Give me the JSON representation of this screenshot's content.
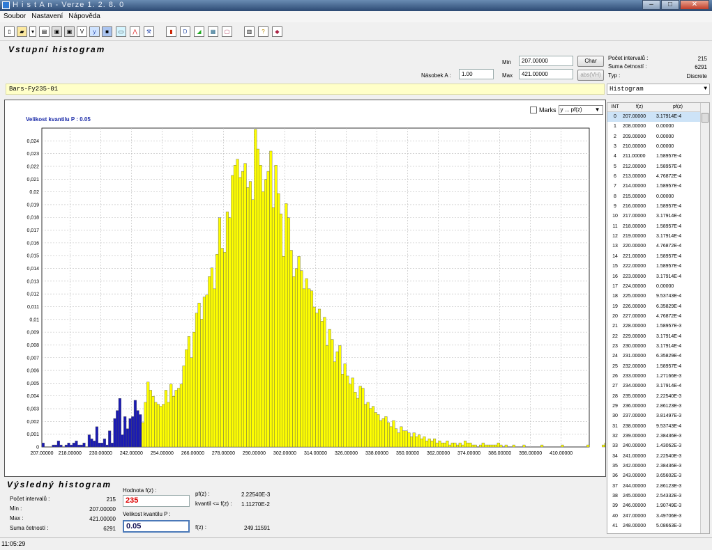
{
  "window": {
    "title": "H i s t A n  -  Verze 1. 2. 8. 0"
  },
  "menu": [
    "Soubor",
    "Nastavení",
    "Nápověda"
  ],
  "input_panel": {
    "title": "Vstupní histogram",
    "min_label": "Min",
    "min_value": "207.00000",
    "max_label": "Max",
    "max_value": "421.00000",
    "nasobek_label": "Násobek A :",
    "nasobek_value": "1.00",
    "char_button": "Char",
    "abs_button": "abs(VH)",
    "pocet_label": "Počet intervalů :",
    "pocet_value": "215",
    "suma_label": "Suma četností :",
    "suma_value": "6291",
    "typ_label": "Typ :",
    "typ_value": "Discrete"
  },
  "dataset_name": "Bars-Fy235-01",
  "view_select": "Histogram",
  "chart_header": {
    "quantile_label": "Velikost kvantilu P : 0.05",
    "marks_label": "Marks",
    "axis_select": "y ... pf(z)"
  },
  "chart_data": {
    "type": "bar",
    "x_start": 207,
    "x_step": 1,
    "xlim": [
      207,
      421
    ],
    "ylim": [
      0,
      0.025
    ],
    "x_ticks": [
      "207.00000",
      "218.00000",
      "230.00000",
      "242.00000",
      "254.00000",
      "266.00000",
      "278.00000",
      "290.00000",
      "302.00000",
      "314.00000",
      "326.00000",
      "338.00000",
      "350.00000",
      "362.00000",
      "374.00000",
      "386.00000",
      "398.00000",
      "410.00000"
    ],
    "y_ticks": [
      "0",
      "0,001",
      "0,002",
      "0,003",
      "0,004",
      "0,005",
      "0,006",
      "0,007",
      "0,008",
      "0,009",
      "0,01",
      "0,011",
      "0,012",
      "0,013",
      "0,014",
      "0,015",
      "0,016",
      "0,017",
      "0,018",
      "0,019",
      "0,02",
      "0,021",
      "0,022",
      "0,023",
      "0,024"
    ],
    "highlight_until_index": 38,
    "highlight_color": "#1a1ab4",
    "bar_color": "#ffff00",
    "grid": true,
    "values": [
      0.000318,
      0,
      0,
      0,
      0.000159,
      0.000159,
      0.000477,
      0.000159,
      0,
      0.000159,
      0.000318,
      0.000159,
      0.000318,
      0.000477,
      0.000159,
      0.000159,
      0.000318,
      0,
      0.000954,
      0.000636,
      0.000477,
      0.00159,
      0.000318,
      0.000318,
      0.000636,
      0.000159,
      0.00127,
      0.000318,
      0.00223,
      0.00286,
      0.00381,
      0.000954,
      0.00238,
      0.00143,
      0.00223,
      0.00238,
      0.00366,
      0.00286,
      0.00254,
      0.00191,
      0.0035,
      0.00509,
      0.00445,
      0.00397,
      0.0035,
      0.00334,
      0.00318,
      0.00334,
      0.00445,
      0.0035,
      0.00493,
      0.00397,
      0.00445,
      0.00461,
      0.00493,
      0.00636,
      0.00763,
      0.00867,
      0.007,
      0.009,
      0.01049,
      0.01129,
      0.01002,
      0.01176,
      0.01192,
      0.01336,
      0.01404,
      0.0124,
      0.01511,
      0.01797,
      0.01558,
      0.01526,
      0.01844,
      0.01797,
      0.02129,
      0.02209,
      0.02256,
      0.02113,
      0.02161,
      0.02223,
      0.02034,
      0.02082,
      0.01939,
      0.0249,
      0.02336,
      0.02209,
      0.02002,
      0.02097,
      0.02161,
      0.0232,
      0.01876,
      0.02209,
      0.01987,
      0.01828,
      0.01494,
      0.01908,
      0.01797,
      0.01542,
      0.01335,
      0.01399,
      0.01494,
      0.01383,
      0.0124,
      0.0132,
      0.0124,
      0.01224,
      0.01097,
      0.01049,
      0.01081,
      0.00986,
      0.01017,
      0.00795,
      0.00922,
      0.00843,
      0.00668,
      0.00747,
      0.00795,
      0.00572,
      0.00652,
      0.00557,
      0.00493,
      0.00541,
      0.00429,
      0.00382,
      0.00477,
      0.00461,
      0.00334,
      0.0035,
      0.00302,
      0.00318,
      0.0027,
      0.00254,
      0.00207,
      0.00222,
      0.00238,
      0.00191,
      0.00159,
      0.00207,
      0.00143,
      0.00111,
      0.00159,
      0.00127,
      0.00127,
      0.00111,
      0.0008,
      0.00111,
      0.0008,
      0.00095,
      0.00064,
      0.0008,
      0.00048,
      0.00064,
      0.00048,
      0.00064,
      0.00032,
      0.00048,
      0.00032,
      0.00032,
      0.00048,
      0.00016,
      0.00032,
      0.00032,
      0.00016,
      0.00032,
      0.00016,
      0.00048,
      0.00032,
      0.00032,
      0.00016,
      0.00016,
      0,
      0.00016,
      0.00032,
      0.00016,
      0.00016,
      0.00016,
      0.00016,
      0.00016,
      0.00032,
      0.00016,
      0,
      0.00016,
      0,
      0,
      0.00016,
      0,
      0,
      0,
      0.00016,
      0,
      0,
      0,
      0,
      0,
      0,
      0.00016,
      0,
      0,
      0,
      0,
      0,
      0,
      0,
      0.00016,
      0,
      0,
      0,
      0,
      0,
      0,
      0,
      0,
      0,
      0.00016,
      0,
      0,
      0,
      0,
      0,
      0.00016,
      0.00032
    ]
  },
  "table": {
    "headers": [
      "INT",
      "f(z)",
      "pf(z)"
    ],
    "rows": [
      [
        "0",
        "207.00000",
        "3.17914E-4"
      ],
      [
        "1",
        "208.00000",
        "0.00000"
      ],
      [
        "2",
        "209.00000",
        "0.00000"
      ],
      [
        "3",
        "210.00000",
        "0.00000"
      ],
      [
        "4",
        "211.00000",
        "1.58957E-4"
      ],
      [
        "5",
        "212.00000",
        "1.58957E-4"
      ],
      [
        "6",
        "213.00000",
        "4.76872E-4"
      ],
      [
        "7",
        "214.00000",
        "1.58957E-4"
      ],
      [
        "8",
        "215.00000",
        "0.00000"
      ],
      [
        "9",
        "216.00000",
        "1.58957E-4"
      ],
      [
        "10",
        "217.00000",
        "3.17914E-4"
      ],
      [
        "11",
        "218.00000",
        "1.58957E-4"
      ],
      [
        "12",
        "219.00000",
        "3.17914E-4"
      ],
      [
        "13",
        "220.00000",
        "4.76872E-4"
      ],
      [
        "14",
        "221.00000",
        "1.58957E-4"
      ],
      [
        "15",
        "222.00000",
        "1.58957E-4"
      ],
      [
        "16",
        "223.00000",
        "3.17914E-4"
      ],
      [
        "17",
        "224.00000",
        "0.00000"
      ],
      [
        "18",
        "225.00000",
        "9.53743E-4"
      ],
      [
        "19",
        "226.00000",
        "6.35829E-4"
      ],
      [
        "20",
        "227.00000",
        "4.76872E-4"
      ],
      [
        "21",
        "228.00000",
        "1.58957E-3"
      ],
      [
        "22",
        "229.00000",
        "3.17914E-4"
      ],
      [
        "23",
        "230.00000",
        "3.17914E-4"
      ],
      [
        "24",
        "231.00000",
        "6.35829E-4"
      ],
      [
        "25",
        "232.00000",
        "1.58957E-4"
      ],
      [
        "26",
        "233.00000",
        "1.27166E-3"
      ],
      [
        "27",
        "234.00000",
        "3.17914E-4"
      ],
      [
        "28",
        "235.00000",
        "2.22540E-3"
      ],
      [
        "29",
        "236.00000",
        "2.86123E-3"
      ],
      [
        "30",
        "237.00000",
        "3.81497E-3"
      ],
      [
        "31",
        "238.00000",
        "9.53743E-4"
      ],
      [
        "32",
        "239.00000",
        "2.38436E-3"
      ],
      [
        "33",
        "240.00000",
        "1.43062E-3"
      ],
      [
        "34",
        "241.00000",
        "2.22540E-3"
      ],
      [
        "35",
        "242.00000",
        "2.38436E-3"
      ],
      [
        "36",
        "243.00000",
        "3.65602E-3"
      ],
      [
        "37",
        "244.00000",
        "2.86123E-3"
      ],
      [
        "38",
        "245.00000",
        "2.54332E-3"
      ],
      [
        "39",
        "246.00000",
        "1.90749E-3"
      ],
      [
        "40",
        "247.00000",
        "3.49706E-3"
      ],
      [
        "41",
        "248.00000",
        "5.08663E-3"
      ]
    ]
  },
  "result_panel": {
    "title": "Výsledný histogram",
    "pocet_label": "Počet intervalů :",
    "pocet_value": "215",
    "min_label": "Min :",
    "min_value": "207.00000",
    "max_label": "Max :",
    "max_value": "421.00000",
    "suma_label": "Suma četností :",
    "suma_value": "6291",
    "hodnota_label": "Hodnota f(z) :",
    "hodnota_value": "235",
    "kvantil_label": "Velikost kvantilu P :",
    "kvantil_value": "0.05",
    "pf_label": "pf(z) :",
    "pf_value": "2.22540E-3",
    "kvantil_le_label": "kvantil <= f(z) :",
    "kvantil_le_value": "1.11270E-2",
    "fz_label": "f(z) :",
    "fz_value": "249.11591"
  },
  "status": {
    "time": "11:05:29"
  }
}
